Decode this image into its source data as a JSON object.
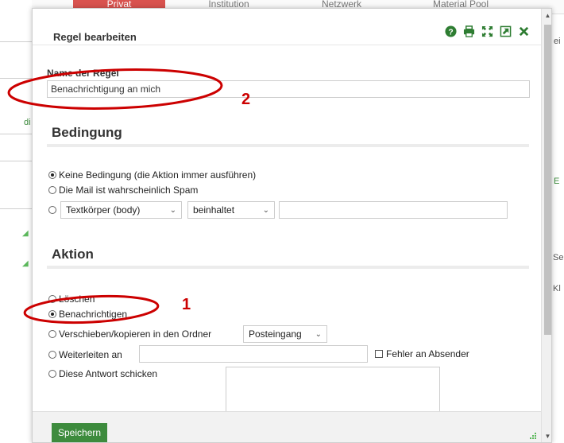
{
  "background": {
    "tabs": [
      "Privat",
      "Institution",
      "Netzwerk",
      "Material Pool"
    ],
    "right_fragments": [
      "ei",
      "E",
      "Se",
      "Kl"
    ],
    "left_fragments": [
      "di"
    ]
  },
  "dialog": {
    "title": "Regel bearbeiten",
    "toolbar_icons": [
      "help-icon",
      "print-icon",
      "fullscreen-icon",
      "popout-icon",
      "close-icon"
    ],
    "name_label": "Name der Regel",
    "name_value": "Benachrichtigung an mich",
    "condition": {
      "heading": "Bedingung",
      "options": [
        {
          "label": "Keine Bedingung (die Aktion immer ausführen)",
          "checked": true
        },
        {
          "label": "Die Mail ist wahrscheinlich Spam",
          "checked": false
        },
        {
          "label": "",
          "checked": false
        }
      ],
      "field_select": "Textkörper (body)",
      "operator_select": "beinhaltet",
      "value": ""
    },
    "action": {
      "heading": "Aktion",
      "options": [
        {
          "label": "Löschen",
          "checked": false
        },
        {
          "label": "Benachrichtigen",
          "checked": true
        },
        {
          "label": "Verschieben/kopieren in den Ordner",
          "checked": false
        },
        {
          "label": "Weiterleiten an",
          "checked": false
        },
        {
          "label": "Diese Antwort schicken",
          "checked": false
        }
      ],
      "folder_select": "Posteingang",
      "forward_value": "",
      "error_checkbox_label": "Fehler an Absender"
    },
    "save_label": "Speichern"
  },
  "annotations": {
    "label_1": "1",
    "label_2": "2",
    "color": "#cc0000"
  },
  "colors": {
    "accent_green": "#3d8b3d",
    "icon_green": "#2e7d32",
    "tab_active": "#d9534f"
  }
}
